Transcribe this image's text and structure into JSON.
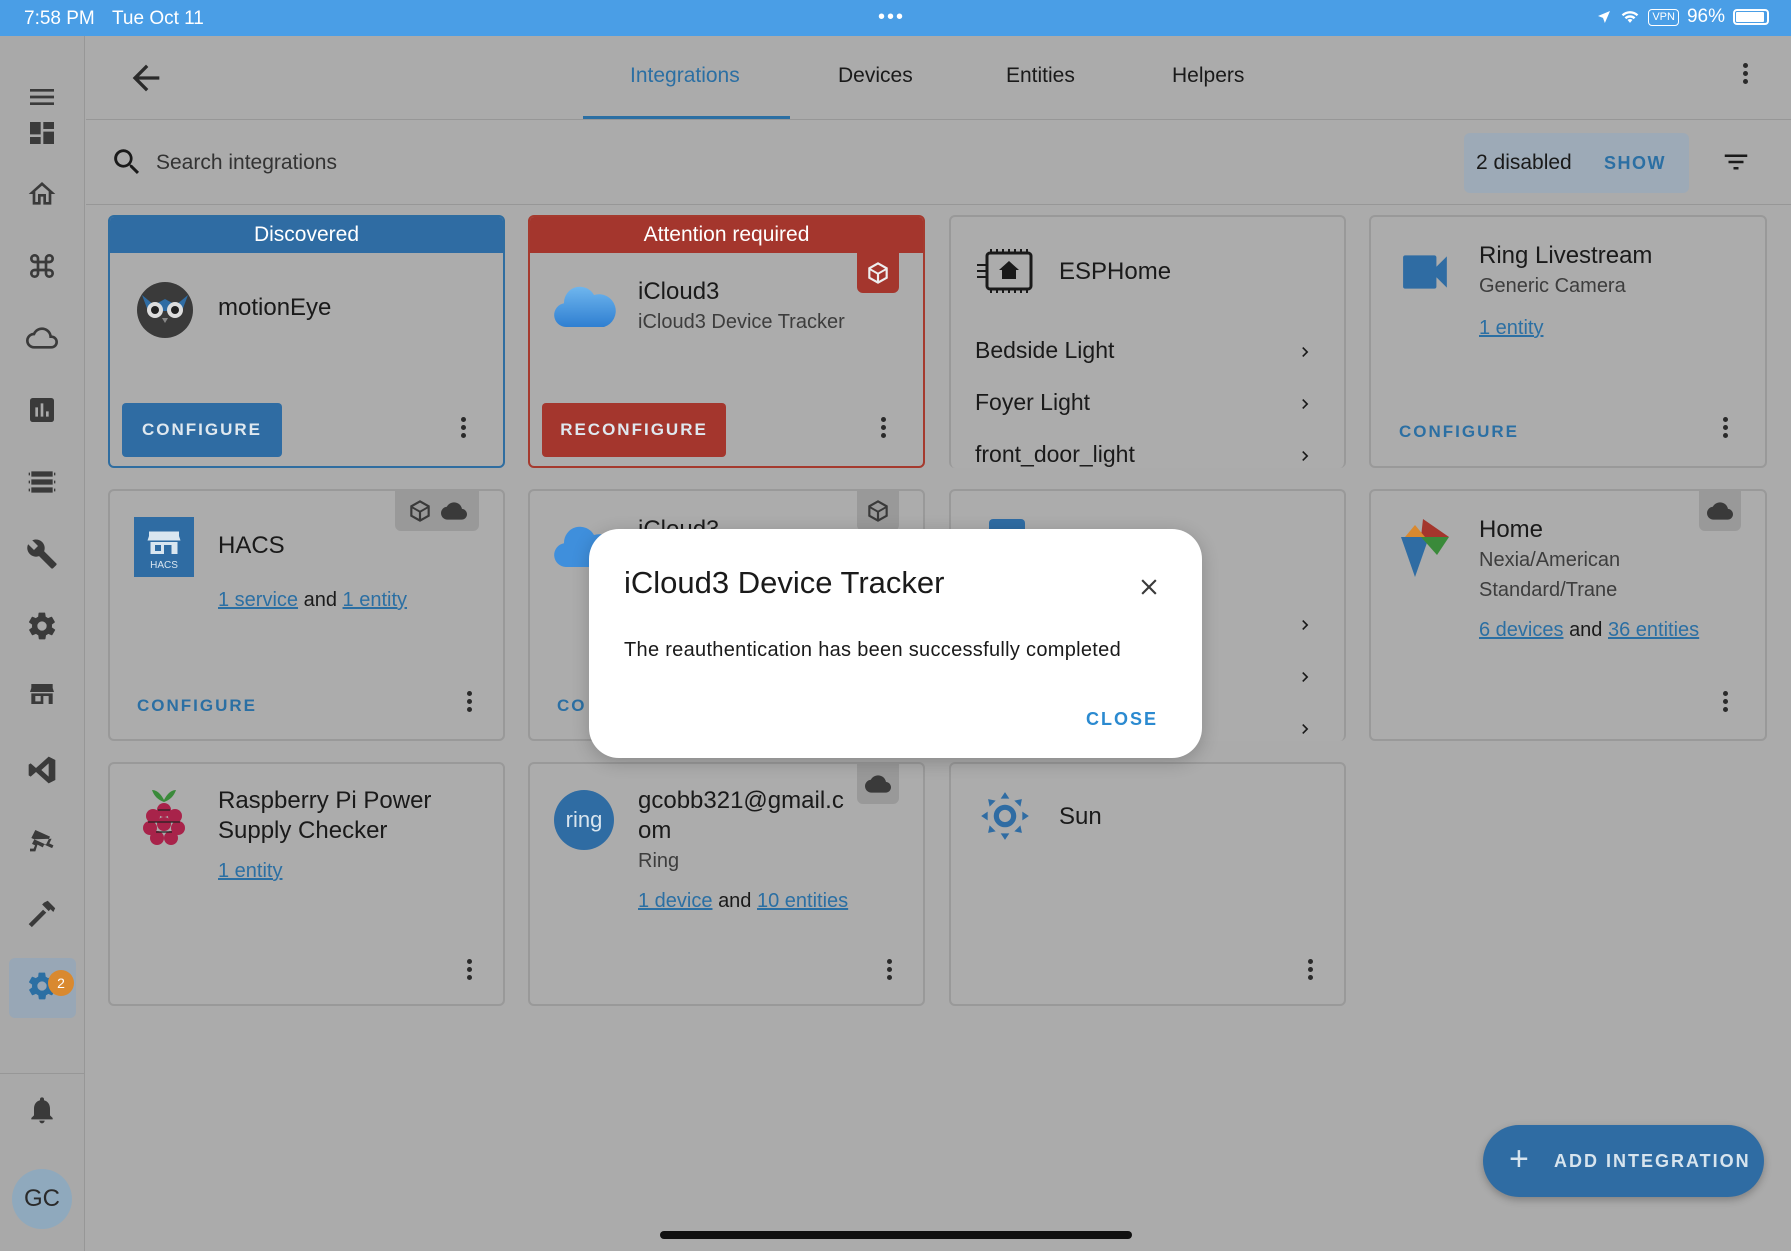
{
  "status_bar": {
    "time": "7:58 PM",
    "date": "Tue Oct 11",
    "dots": "•••",
    "vpn": "VPN",
    "battery": "96%"
  },
  "tabs": [
    {
      "label": "Integrations",
      "active": true
    },
    {
      "label": "Devices"
    },
    {
      "label": "Entities"
    },
    {
      "label": "Helpers"
    }
  ],
  "search": {
    "placeholder": "Search integrations"
  },
  "disabled_filter": {
    "count_label": "2 disabled",
    "action": "SHOW"
  },
  "sidebar": {
    "badge_count": "2",
    "avatar_initials": "GC"
  },
  "cards": {
    "motioneye": {
      "header": "Discovered",
      "title": "motionEye",
      "button": "CONFIGURE"
    },
    "icloud3": {
      "header": "Attention required",
      "title": "iCloud3",
      "subtitle": "iCloud3 Device Tracker",
      "button": "RECONFIGURE"
    },
    "esphome": {
      "title": "ESPHome",
      "items": [
        "Bedside Light",
        "Foyer Light",
        "front_door_light"
      ]
    },
    "ring_livestream": {
      "title": "Ring Livestream",
      "subtitle": "Generic Camera",
      "link": "1 entity",
      "button": "CONFIGURE"
    },
    "hacs": {
      "title": "HACS",
      "logo_text": "HACS",
      "link1": "1 service",
      "and": "and",
      "link2": "1 entity",
      "button": "CONFIGURE"
    },
    "icloud3_b": {
      "title": "iCloud3",
      "button_partial": "CO"
    },
    "home": {
      "title": "Home",
      "subtitle_line1": "Nexia/American",
      "subtitle_line2": "Standard/Trane",
      "link1": "6 devices",
      "and": "and",
      "link2": "36 entities"
    },
    "raspberry": {
      "title_line1": "Raspberry Pi Power",
      "title_line2": "Supply Checker",
      "link": "1 entity"
    },
    "ring": {
      "logo_text": "ring",
      "title_line1": "gcobb321@gmail.c",
      "title_line2": "om",
      "subtitle": "Ring",
      "link1": "1 device",
      "and": "and",
      "link2": "10 entities"
    },
    "sun": {
      "title": "Sun"
    }
  },
  "modal": {
    "title": "iCloud3 Device Tracker",
    "message": "The reauthentication has been successfully completed",
    "close_button": "CLOSE"
  },
  "fab": {
    "label": "ADD INTEGRATION",
    "icon": "+"
  },
  "colors": {
    "primary": "#2f6ca3",
    "attention": "#a4362d",
    "status_bar": "#4a9ee6"
  }
}
